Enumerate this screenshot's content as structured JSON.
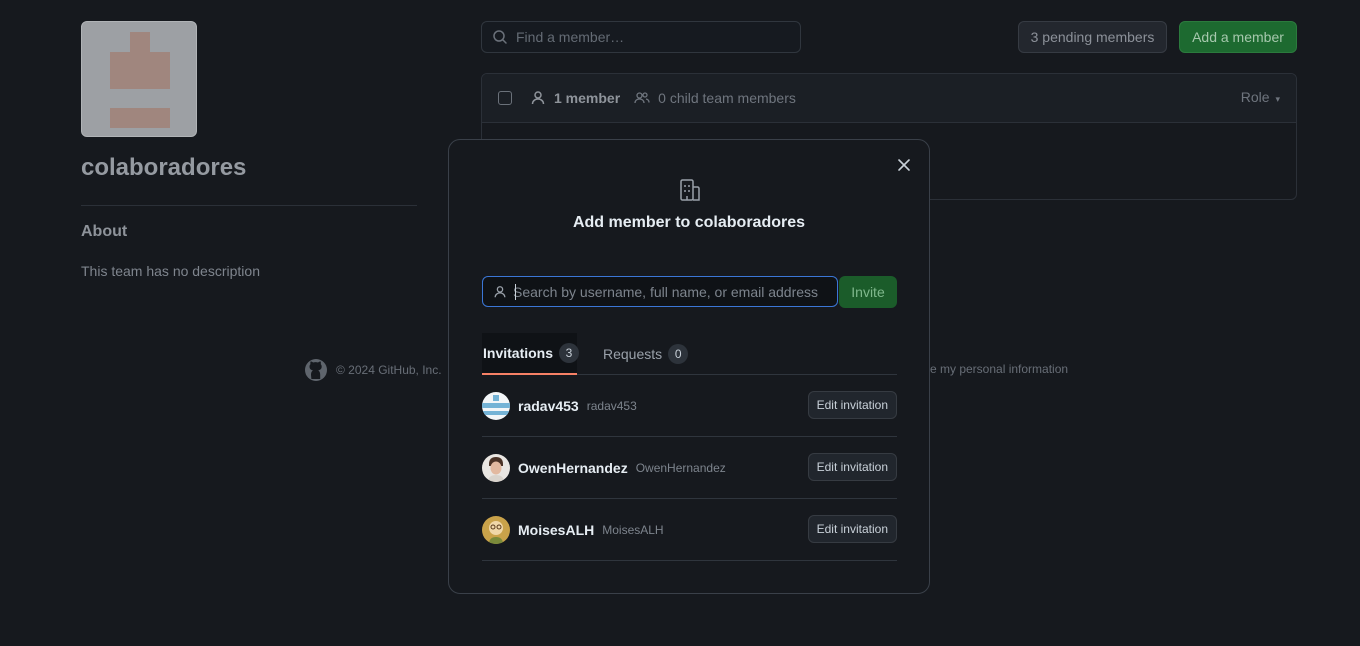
{
  "team": {
    "name": "colaboradores",
    "about_title": "About",
    "about_desc": "This team has no description"
  },
  "toolbar": {
    "find_placeholder": "Find a member…",
    "pending_label": "3 pending members",
    "add_label": "Add a member"
  },
  "members_header": {
    "member_count": "1 member",
    "child_count": "0 child team members",
    "role_label": "Role"
  },
  "footer": {
    "copyright": "© 2024 GitHub, Inc.",
    "right_text": "e my personal information"
  },
  "modal": {
    "title": "Add member to colaboradores",
    "search_placeholder": "Search by username, full name, or email address",
    "invite_label": "Invite",
    "tabs": [
      {
        "label": "Invitations",
        "count": "3"
      },
      {
        "label": "Requests",
        "count": "0"
      }
    ],
    "invitations": [
      {
        "name": "radav453",
        "login": "radav453",
        "action": "Edit invitation"
      },
      {
        "name": "OwenHernandez",
        "login": "OwenHernandez",
        "action": "Edit invitation"
      },
      {
        "name": "MoisesALH",
        "login": "MoisesALH",
        "action": "Edit invitation"
      }
    ]
  },
  "colors": {
    "background": "#16191e",
    "accent_green": "#1b5c2a",
    "focus_blue": "#3b76d6",
    "tab_underline": "#f78166"
  }
}
